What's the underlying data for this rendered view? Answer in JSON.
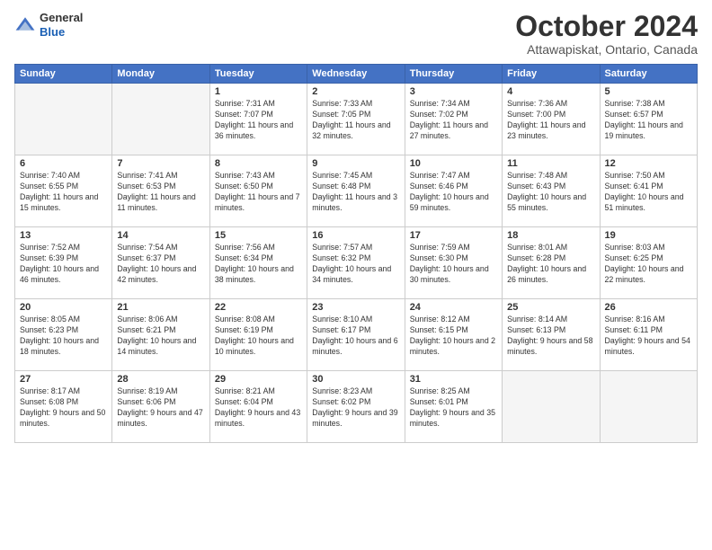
{
  "header": {
    "logo_general": "General",
    "logo_blue": "Blue",
    "title": "October 2024",
    "location": "Attawapiskat, Ontario, Canada"
  },
  "days_of_week": [
    "Sunday",
    "Monday",
    "Tuesday",
    "Wednesday",
    "Thursday",
    "Friday",
    "Saturday"
  ],
  "weeks": [
    [
      {
        "day": "",
        "empty": true
      },
      {
        "day": "",
        "empty": true
      },
      {
        "day": "1",
        "sunrise": "Sunrise: 7:31 AM",
        "sunset": "Sunset: 7:07 PM",
        "daylight": "Daylight: 11 hours and 36 minutes."
      },
      {
        "day": "2",
        "sunrise": "Sunrise: 7:33 AM",
        "sunset": "Sunset: 7:05 PM",
        "daylight": "Daylight: 11 hours and 32 minutes."
      },
      {
        "day": "3",
        "sunrise": "Sunrise: 7:34 AM",
        "sunset": "Sunset: 7:02 PM",
        "daylight": "Daylight: 11 hours and 27 minutes."
      },
      {
        "day": "4",
        "sunrise": "Sunrise: 7:36 AM",
        "sunset": "Sunset: 7:00 PM",
        "daylight": "Daylight: 11 hours and 23 minutes."
      },
      {
        "day": "5",
        "sunrise": "Sunrise: 7:38 AM",
        "sunset": "Sunset: 6:57 PM",
        "daylight": "Daylight: 11 hours and 19 minutes."
      }
    ],
    [
      {
        "day": "6",
        "sunrise": "Sunrise: 7:40 AM",
        "sunset": "Sunset: 6:55 PM",
        "daylight": "Daylight: 11 hours and 15 minutes."
      },
      {
        "day": "7",
        "sunrise": "Sunrise: 7:41 AM",
        "sunset": "Sunset: 6:53 PM",
        "daylight": "Daylight: 11 hours and 11 minutes."
      },
      {
        "day": "8",
        "sunrise": "Sunrise: 7:43 AM",
        "sunset": "Sunset: 6:50 PM",
        "daylight": "Daylight: 11 hours and 7 minutes."
      },
      {
        "day": "9",
        "sunrise": "Sunrise: 7:45 AM",
        "sunset": "Sunset: 6:48 PM",
        "daylight": "Daylight: 11 hours and 3 minutes."
      },
      {
        "day": "10",
        "sunrise": "Sunrise: 7:47 AM",
        "sunset": "Sunset: 6:46 PM",
        "daylight": "Daylight: 10 hours and 59 minutes."
      },
      {
        "day": "11",
        "sunrise": "Sunrise: 7:48 AM",
        "sunset": "Sunset: 6:43 PM",
        "daylight": "Daylight: 10 hours and 55 minutes."
      },
      {
        "day": "12",
        "sunrise": "Sunrise: 7:50 AM",
        "sunset": "Sunset: 6:41 PM",
        "daylight": "Daylight: 10 hours and 51 minutes."
      }
    ],
    [
      {
        "day": "13",
        "sunrise": "Sunrise: 7:52 AM",
        "sunset": "Sunset: 6:39 PM",
        "daylight": "Daylight: 10 hours and 46 minutes."
      },
      {
        "day": "14",
        "sunrise": "Sunrise: 7:54 AM",
        "sunset": "Sunset: 6:37 PM",
        "daylight": "Daylight: 10 hours and 42 minutes."
      },
      {
        "day": "15",
        "sunrise": "Sunrise: 7:56 AM",
        "sunset": "Sunset: 6:34 PM",
        "daylight": "Daylight: 10 hours and 38 minutes."
      },
      {
        "day": "16",
        "sunrise": "Sunrise: 7:57 AM",
        "sunset": "Sunset: 6:32 PM",
        "daylight": "Daylight: 10 hours and 34 minutes."
      },
      {
        "day": "17",
        "sunrise": "Sunrise: 7:59 AM",
        "sunset": "Sunset: 6:30 PM",
        "daylight": "Daylight: 10 hours and 30 minutes."
      },
      {
        "day": "18",
        "sunrise": "Sunrise: 8:01 AM",
        "sunset": "Sunset: 6:28 PM",
        "daylight": "Daylight: 10 hours and 26 minutes."
      },
      {
        "day": "19",
        "sunrise": "Sunrise: 8:03 AM",
        "sunset": "Sunset: 6:25 PM",
        "daylight": "Daylight: 10 hours and 22 minutes."
      }
    ],
    [
      {
        "day": "20",
        "sunrise": "Sunrise: 8:05 AM",
        "sunset": "Sunset: 6:23 PM",
        "daylight": "Daylight: 10 hours and 18 minutes."
      },
      {
        "day": "21",
        "sunrise": "Sunrise: 8:06 AM",
        "sunset": "Sunset: 6:21 PM",
        "daylight": "Daylight: 10 hours and 14 minutes."
      },
      {
        "day": "22",
        "sunrise": "Sunrise: 8:08 AM",
        "sunset": "Sunset: 6:19 PM",
        "daylight": "Daylight: 10 hours and 10 minutes."
      },
      {
        "day": "23",
        "sunrise": "Sunrise: 8:10 AM",
        "sunset": "Sunset: 6:17 PM",
        "daylight": "Daylight: 10 hours and 6 minutes."
      },
      {
        "day": "24",
        "sunrise": "Sunrise: 8:12 AM",
        "sunset": "Sunset: 6:15 PM",
        "daylight": "Daylight: 10 hours and 2 minutes."
      },
      {
        "day": "25",
        "sunrise": "Sunrise: 8:14 AM",
        "sunset": "Sunset: 6:13 PM",
        "daylight": "Daylight: 9 hours and 58 minutes."
      },
      {
        "day": "26",
        "sunrise": "Sunrise: 8:16 AM",
        "sunset": "Sunset: 6:11 PM",
        "daylight": "Daylight: 9 hours and 54 minutes."
      }
    ],
    [
      {
        "day": "27",
        "sunrise": "Sunrise: 8:17 AM",
        "sunset": "Sunset: 6:08 PM",
        "daylight": "Daylight: 9 hours and 50 minutes."
      },
      {
        "day": "28",
        "sunrise": "Sunrise: 8:19 AM",
        "sunset": "Sunset: 6:06 PM",
        "daylight": "Daylight: 9 hours and 47 minutes."
      },
      {
        "day": "29",
        "sunrise": "Sunrise: 8:21 AM",
        "sunset": "Sunset: 6:04 PM",
        "daylight": "Daylight: 9 hours and 43 minutes."
      },
      {
        "day": "30",
        "sunrise": "Sunrise: 8:23 AM",
        "sunset": "Sunset: 6:02 PM",
        "daylight": "Daylight: 9 hours and 39 minutes."
      },
      {
        "day": "31",
        "sunrise": "Sunrise: 8:25 AM",
        "sunset": "Sunset: 6:01 PM",
        "daylight": "Daylight: 9 hours and 35 minutes."
      },
      {
        "day": "",
        "empty": true
      },
      {
        "day": "",
        "empty": true
      }
    ]
  ]
}
